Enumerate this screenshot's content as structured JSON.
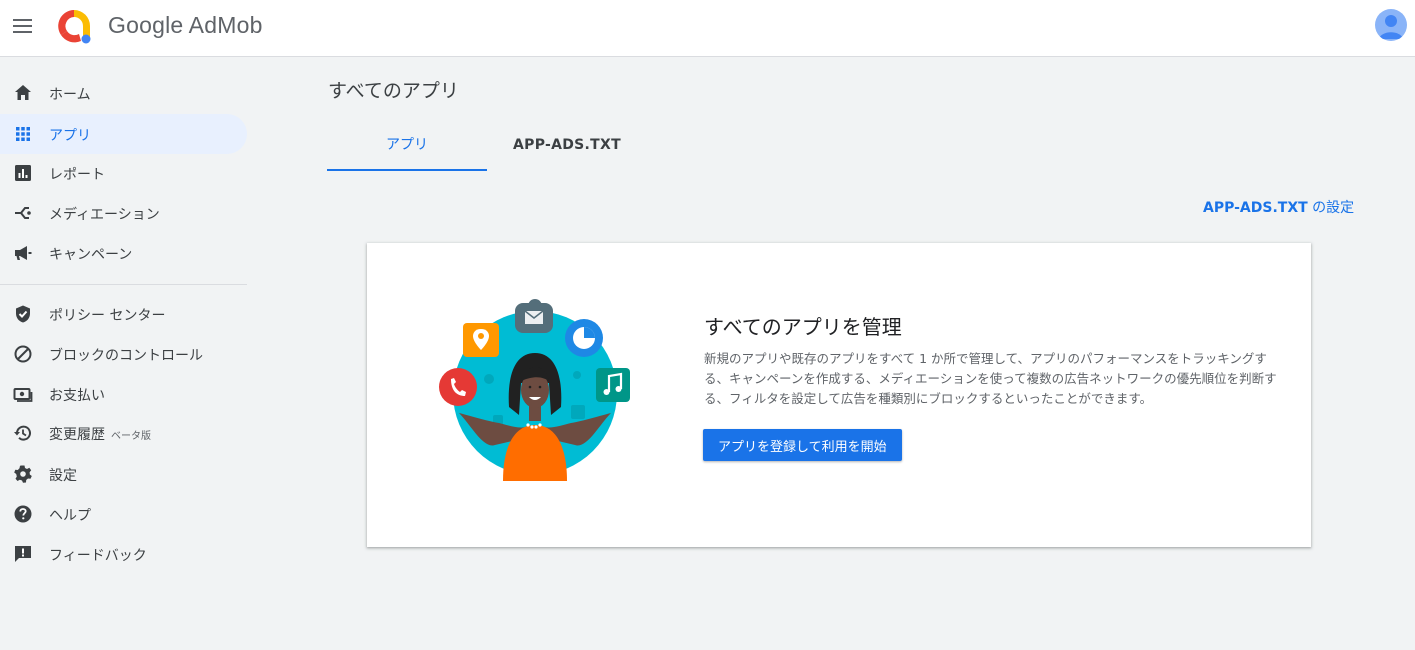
{
  "header": {
    "brand": "Google AdMob",
    "menu_icon": "hamburger-menu-icon",
    "logo_icon": "admob-logo-icon",
    "avatar_icon": "user-avatar-icon"
  },
  "sidebar": {
    "items": [
      {
        "label": "ホーム",
        "icon": "home-icon",
        "active": false
      },
      {
        "label": "アプリ",
        "icon": "apps-grid-icon",
        "active": true
      },
      {
        "label": "レポート",
        "icon": "bar-chart-icon",
        "active": false
      },
      {
        "label": "メディエーション",
        "icon": "mediation-icon",
        "active": false
      },
      {
        "label": "キャンペーン",
        "icon": "megaphone-icon",
        "active": false
      },
      {
        "label": "ポリシー センター",
        "icon": "shield-check-icon",
        "active": false
      },
      {
        "label": "ブロックのコントロール",
        "icon": "block-icon",
        "active": false
      },
      {
        "label": "お支払い",
        "icon": "payments-icon",
        "active": false
      },
      {
        "label": "変更履歴",
        "badge": "ベータ版",
        "icon": "history-icon",
        "active": false
      },
      {
        "label": "設定",
        "icon": "gear-icon",
        "active": false
      },
      {
        "label": "ヘルプ",
        "icon": "help-icon",
        "active": false
      },
      {
        "label": "フィードバック",
        "icon": "feedback-icon",
        "active": false
      }
    ]
  },
  "main": {
    "title": "すべてのアプリ",
    "tabs": [
      {
        "label": "アプリ",
        "active": true
      },
      {
        "label": "APP-ADS.TXT",
        "active": false
      }
    ],
    "settings_link": {
      "strong": "APP-ADS.TXT",
      "rest": " の設定"
    },
    "card": {
      "title": "すべてのアプリを管理",
      "description": "新規のアプリや既存のアプリをすべて 1 か所で管理して、アプリのパフォーマンスをトラッキングする、キャンペーンを作成する、メディエーションを使って複数の広告ネットワークの優先順位を判断する、フィルタを設定して広告を種類別にブロックするといったことができます。",
      "cta_label": "アプリを登録して利用を開始",
      "illustration": "woman-juggling-apps-illustration"
    }
  },
  "colors": {
    "accent": "#1a73e8",
    "active_nav_bg": "#e8f0fe",
    "page_bg": "#f1f3f4"
  }
}
